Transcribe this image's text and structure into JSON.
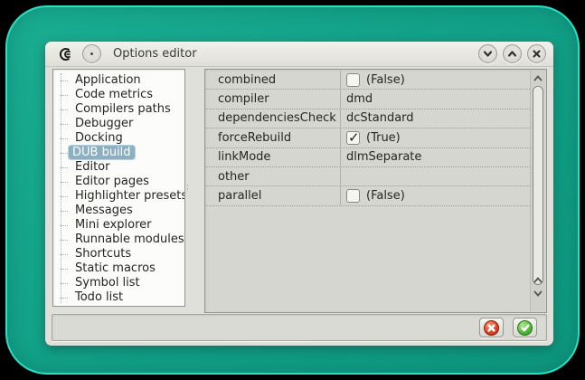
{
  "window": {
    "title": "Options editor",
    "app_icon": "coedit-logo"
  },
  "titlebar_buttons": [
    {
      "name": "shade-button",
      "icon": "chevron-down-icon"
    },
    {
      "name": "restore-button",
      "icon": "chevron-up-icon"
    },
    {
      "name": "close-button",
      "icon": "close-icon"
    }
  ],
  "sidebar": {
    "items": [
      "Application",
      "Code metrics",
      "Compilers paths",
      "Debugger",
      "Docking",
      "DUB build",
      "Editor",
      "Editor pages",
      "Highlighter presets",
      "Messages",
      "Mini explorer",
      "Runnable modules",
      "Shortcuts",
      "Static macros",
      "Symbol list",
      "Todo list"
    ],
    "selected_index": 5,
    "selected_label": "DUB build"
  },
  "properties": {
    "rows": [
      {
        "name": "combined",
        "type": "checkbox",
        "checked": false,
        "value": "(False)"
      },
      {
        "name": "compiler",
        "type": "text",
        "value": "dmd"
      },
      {
        "name": "dependenciesCheck",
        "type": "text",
        "value": "dcStandard"
      },
      {
        "name": "forceRebuild",
        "type": "checkbox",
        "checked": true,
        "value": "(True)"
      },
      {
        "name": "linkMode",
        "type": "text",
        "value": "dlmSeparate"
      },
      {
        "name": "other",
        "type": "text",
        "value": ""
      },
      {
        "name": "parallel",
        "type": "checkbox",
        "checked": false,
        "value": "(False)"
      }
    ]
  },
  "footer": {
    "buttons": [
      {
        "name": "cancel-button",
        "icon": "red-cross-orb-icon"
      },
      {
        "name": "accept-button",
        "icon": "green-check-orb-icon"
      }
    ]
  },
  "colors": {
    "desktop_teal": "#12a189",
    "edge_cyan": "#2adfc3",
    "selection_blue": "#8cb0c1",
    "cancel_red": "#dc4a26",
    "accept_green": "#55b93a"
  }
}
